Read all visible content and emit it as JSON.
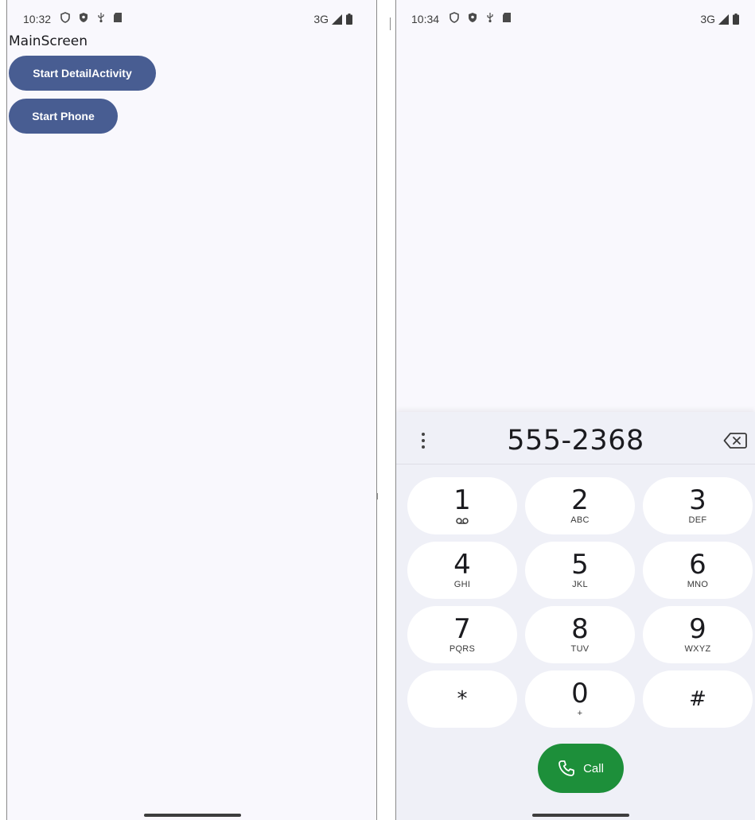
{
  "left": {
    "status": {
      "time": "10:32",
      "network": "3G"
    },
    "title": "MainScreen",
    "buttons": {
      "detail": "Start DetailActivity",
      "phone": "Start Phone"
    }
  },
  "right": {
    "status": {
      "time": "10:34",
      "network": "3G"
    },
    "dialed_number": "555-2368",
    "keys": [
      {
        "digit": "1",
        "letters": "",
        "sub_icon": "voicemail-icon"
      },
      {
        "digit": "2",
        "letters": "ABC"
      },
      {
        "digit": "3",
        "letters": "DEF"
      },
      {
        "digit": "4",
        "letters": "GHI"
      },
      {
        "digit": "5",
        "letters": "JKL"
      },
      {
        "digit": "6",
        "letters": "MNO"
      },
      {
        "digit": "7",
        "letters": "PQRS"
      },
      {
        "digit": "8",
        "letters": "TUV"
      },
      {
        "digit": "9",
        "letters": "WXYZ"
      },
      {
        "digit": "*",
        "letters": ""
      },
      {
        "digit": "0",
        "letters": "+"
      },
      {
        "digit": "#",
        "letters": ""
      }
    ],
    "call_label": "Call"
  },
  "colors": {
    "accent_button": "#485d92",
    "call_green": "#1d8f3a",
    "screen_bg": "#f9f8fd",
    "dialer_bg": "#eff0f7"
  }
}
